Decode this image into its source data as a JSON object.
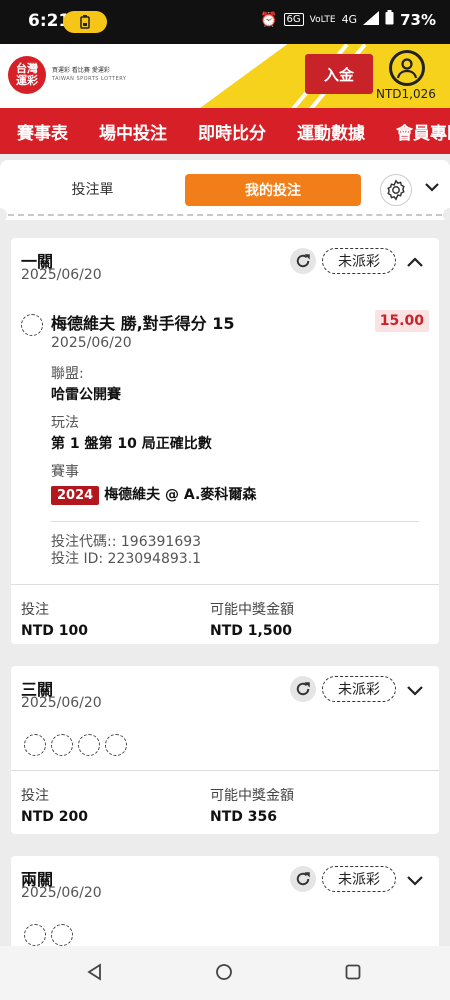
{
  "status_bar": {
    "time": "6:21",
    "battery_pct": "73%",
    "network": "4G"
  },
  "header": {
    "logo_line1": "台灣",
    "logo_line2": "運彩",
    "logo_tagline": "買運彩 看比賽 愛運彩",
    "logo_sub": "TAIWAN SPORTS LOTTERY",
    "deposit_label": "入金",
    "balance": "NTD1,026"
  },
  "nav": {
    "items": [
      "賽事表",
      "場中投注",
      "即時比分",
      "運動數據",
      "會員專區"
    ]
  },
  "tabs": {
    "slip": "投注單",
    "mine": "我的投注"
  },
  "bets": [
    {
      "title": "一關",
      "date": "2025/06/20",
      "status": "未派彩",
      "leg": {
        "title": "梅德維夫 勝,對手得分 15",
        "date": "2025/06/20",
        "odds": "15.00",
        "league_label": "聯盟:",
        "league": "哈雷公開賽",
        "market_label": "玩法",
        "market": "第 1 盤第 10 局正確比數",
        "event_label": "賽事",
        "event_year": "2024",
        "event": "梅德維夫 @ A.麥科爾森"
      },
      "bet_code": "投注代碼:: 196391693",
      "bet_id": "投注 ID: 223094893.1",
      "stake_label": "投注",
      "stake": "NTD 100",
      "payout_label": "可能中獎金額",
      "payout": "NTD 1,500"
    },
    {
      "title": "三關",
      "date": "2025/06/20",
      "status": "未派彩",
      "stake_label": "投注",
      "stake": "NTD 200",
      "payout_label": "可能中獎金額",
      "payout": "NTD 356"
    },
    {
      "title": "兩關",
      "date": "2025/06/20",
      "status": "未派彩"
    }
  ]
}
